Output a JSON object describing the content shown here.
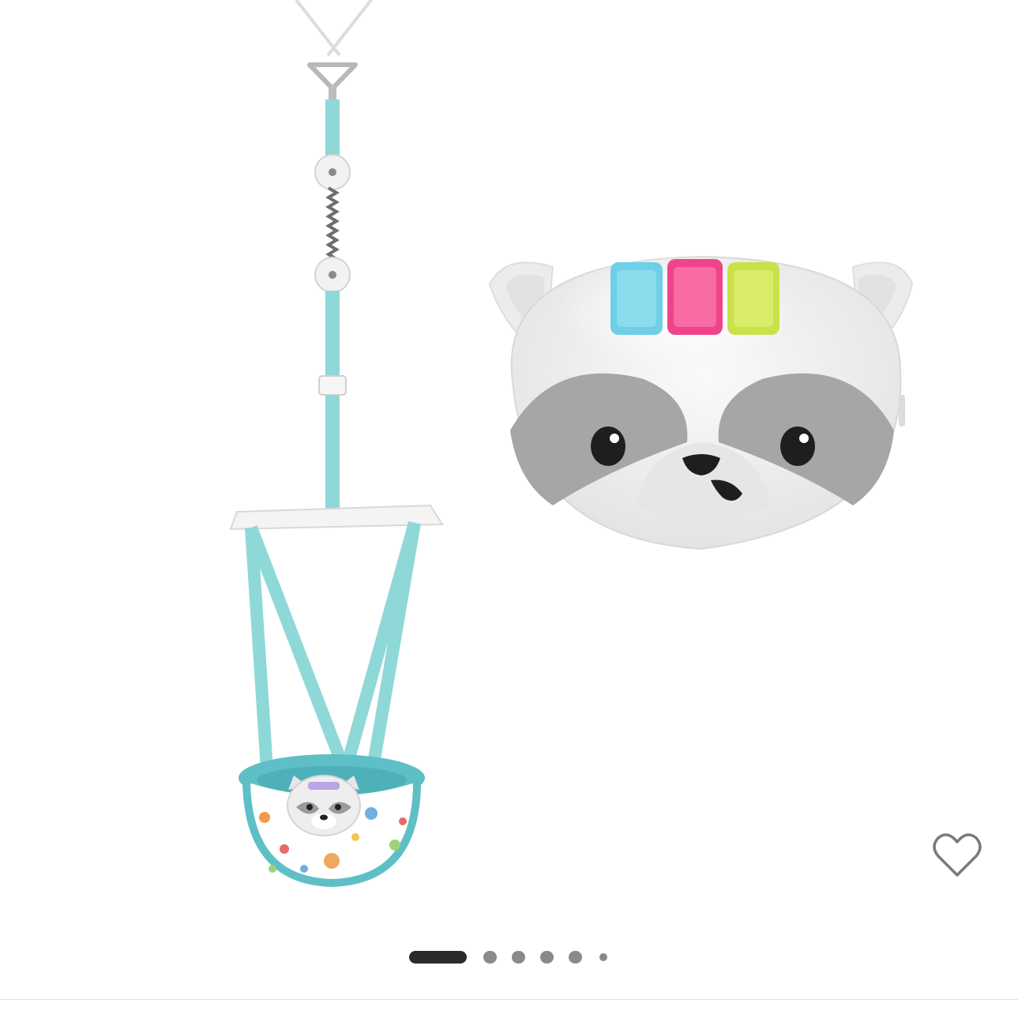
{
  "gallery": {
    "favorite": {
      "icon": "heart-outline-icon",
      "color": "#7a7a7a"
    },
    "pagination": {
      "total_dots": 6,
      "active_index": 0,
      "active_color": "#2b2b2b",
      "inactive_color": "#8a8a8a"
    }
  },
  "colors": {
    "background": "#ffffff",
    "strap_teal": "#8fd8d8",
    "divider": "#e2e2e2"
  },
  "product": {
    "left_item": "door-jumper-illustration",
    "right_item": "raccoon-toy-illustration"
  }
}
